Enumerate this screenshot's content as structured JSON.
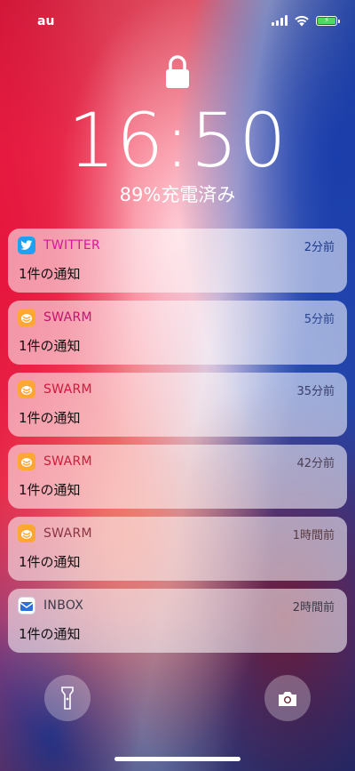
{
  "status_bar": {
    "carrier": "au",
    "battery_color": "#4cd964"
  },
  "lock_screen": {
    "time": "16:50",
    "battery_status": "89%充電済み"
  },
  "notifications": [
    {
      "app": "TWITTER",
      "time": "2分前",
      "body": "1件の通知",
      "icon": "twitter-bird-icon",
      "icon_color": "#1da1f2"
    },
    {
      "app": "SWARM",
      "time": "5分前",
      "body": "1件の通知",
      "icon": "swarm-bee-icon",
      "icon_color": "#ffa633"
    },
    {
      "app": "SWARM",
      "time": "35分前",
      "body": "1件の通知",
      "icon": "swarm-bee-icon",
      "icon_color": "#ffa633"
    },
    {
      "app": "SWARM",
      "time": "42分前",
      "body": "1件の通知",
      "icon": "swarm-bee-icon",
      "icon_color": "#ffa633"
    },
    {
      "app": "SWARM",
      "time": "1時間前",
      "body": "1件の通知",
      "icon": "swarm-bee-icon",
      "icon_color": "#ffa633"
    },
    {
      "app": "INBOX",
      "time": "2時間前",
      "body": "1件の通知",
      "icon": "inbox-envelope-icon",
      "icon_color": "#2a6fdb"
    }
  ],
  "quick_actions": {
    "left": "flashlight-icon",
    "right": "camera-icon"
  }
}
